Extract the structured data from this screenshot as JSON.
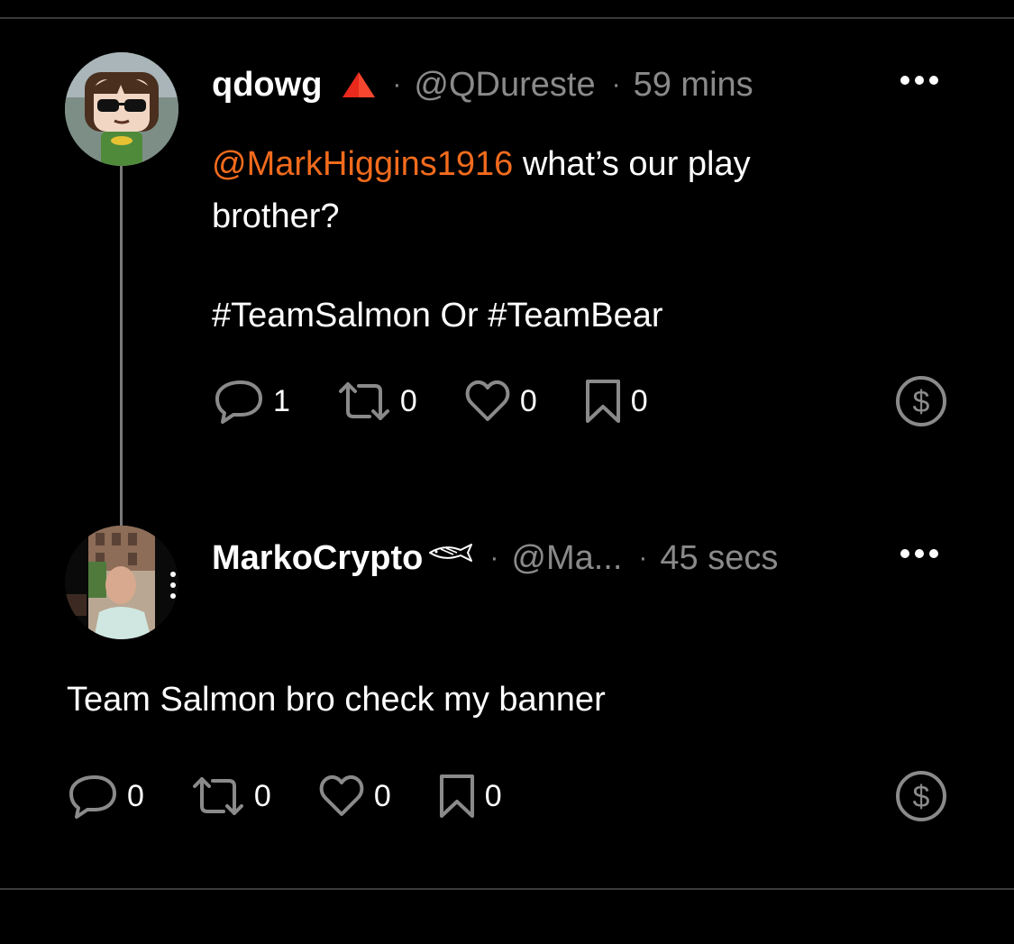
{
  "colors": {
    "background": "#000000",
    "accent_mention": "#f26b1d",
    "muted_text": "#8a8a8a",
    "badge_red": "#e8291c",
    "divider": "#3a3a3a"
  },
  "posts": [
    {
      "display_name": "qdowg",
      "badge_icon": "red-triangle-icon",
      "separator": "·",
      "handle": "@QDureste",
      "time_separator": "·",
      "time": "59 mins",
      "mention": "@MarkHiggins1916",
      "text_line1": " what’s our play",
      "text_line2": "brother?",
      "text_line3": "#TeamSalmon Or #TeamBear",
      "actions": {
        "replies": "1",
        "reposts": "0",
        "likes": "0",
        "bookmarks": "0"
      }
    },
    {
      "display_name": "MarkoCrypto",
      "badge_icon": "fish-icon",
      "separator": "·",
      "handle": "@Ma...",
      "time_separator": "·",
      "time": "45 secs",
      "text": "Team Salmon bro check my banner",
      "actions": {
        "replies": "0",
        "reposts": "0",
        "likes": "0",
        "bookmarks": "0"
      }
    }
  ]
}
